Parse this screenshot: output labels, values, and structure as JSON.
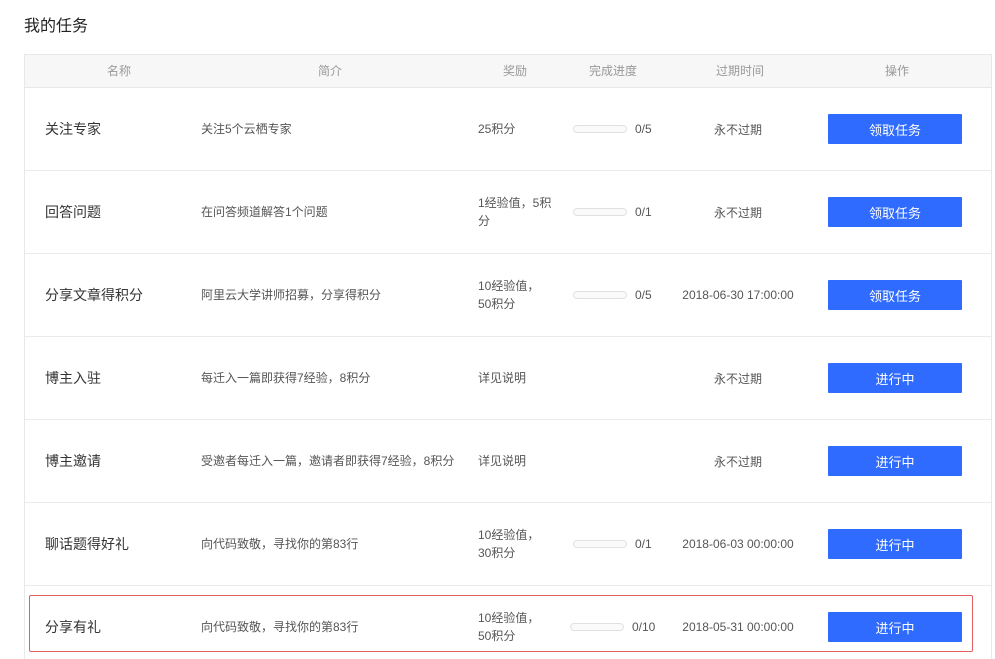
{
  "page": {
    "title": "我的任务"
  },
  "table": {
    "headers": {
      "name": "名称",
      "desc": "简介",
      "reward": "奖励",
      "progress": "完成进度",
      "expire": "过期时间",
      "action": "操作"
    },
    "rows": [
      {
        "name": "关注专家",
        "desc": "关注5个云栖专家",
        "reward": "25积分",
        "progress_text": "0/5",
        "progress_fraction": 0,
        "show_progress": true,
        "expire": "永不过期",
        "action": "领取任务",
        "highlighted": false
      },
      {
        "name": "回答问题",
        "desc": "在问答频道解答1个问题",
        "reward": "1经验值，5积分",
        "progress_text": "0/1",
        "progress_fraction": 0,
        "show_progress": true,
        "expire": "永不过期",
        "action": "领取任务",
        "highlighted": false
      },
      {
        "name": "分享文章得积分",
        "desc": "阿里云大学讲师招募，分享得积分",
        "reward": "10经验值，50积分",
        "progress_text": "0/5",
        "progress_fraction": 0,
        "show_progress": true,
        "expire": "2018-06-30 17:00:00",
        "action": "领取任务",
        "highlighted": false
      },
      {
        "name": "博主入驻",
        "desc": "每迁入一篇即获得7经验，8积分",
        "reward": "详见说明",
        "progress_text": "",
        "progress_fraction": 0,
        "show_progress": false,
        "expire": "永不过期",
        "action": "进行中",
        "highlighted": false
      },
      {
        "name": "博主邀请",
        "desc": "受邀者每迁入一篇，邀请者即获得7经验，8积分",
        "reward": "详见说明",
        "progress_text": "",
        "progress_fraction": 0,
        "show_progress": false,
        "expire": "永不过期",
        "action": "进行中",
        "highlighted": false
      },
      {
        "name": "聊话题得好礼",
        "desc": "向代码致敬，寻找你的第83行",
        "reward": "10经验值，30积分",
        "progress_text": "0/1",
        "progress_fraction": 0,
        "show_progress": true,
        "expire": "2018-06-03 00:00:00",
        "action": "进行中",
        "highlighted": false
      },
      {
        "name": "分享有礼",
        "desc": "向代码致敬，寻找你的第83行",
        "reward": "10经验值，50积分",
        "progress_text": "0/10",
        "progress_fraction": 0,
        "show_progress": true,
        "expire": "2018-05-31 00:00:00",
        "action": "进行中",
        "highlighted": true
      }
    ]
  },
  "colors": {
    "button": "#2f6bff",
    "highlight_border": "#e06060",
    "header_bg": "#f7f7f7"
  }
}
